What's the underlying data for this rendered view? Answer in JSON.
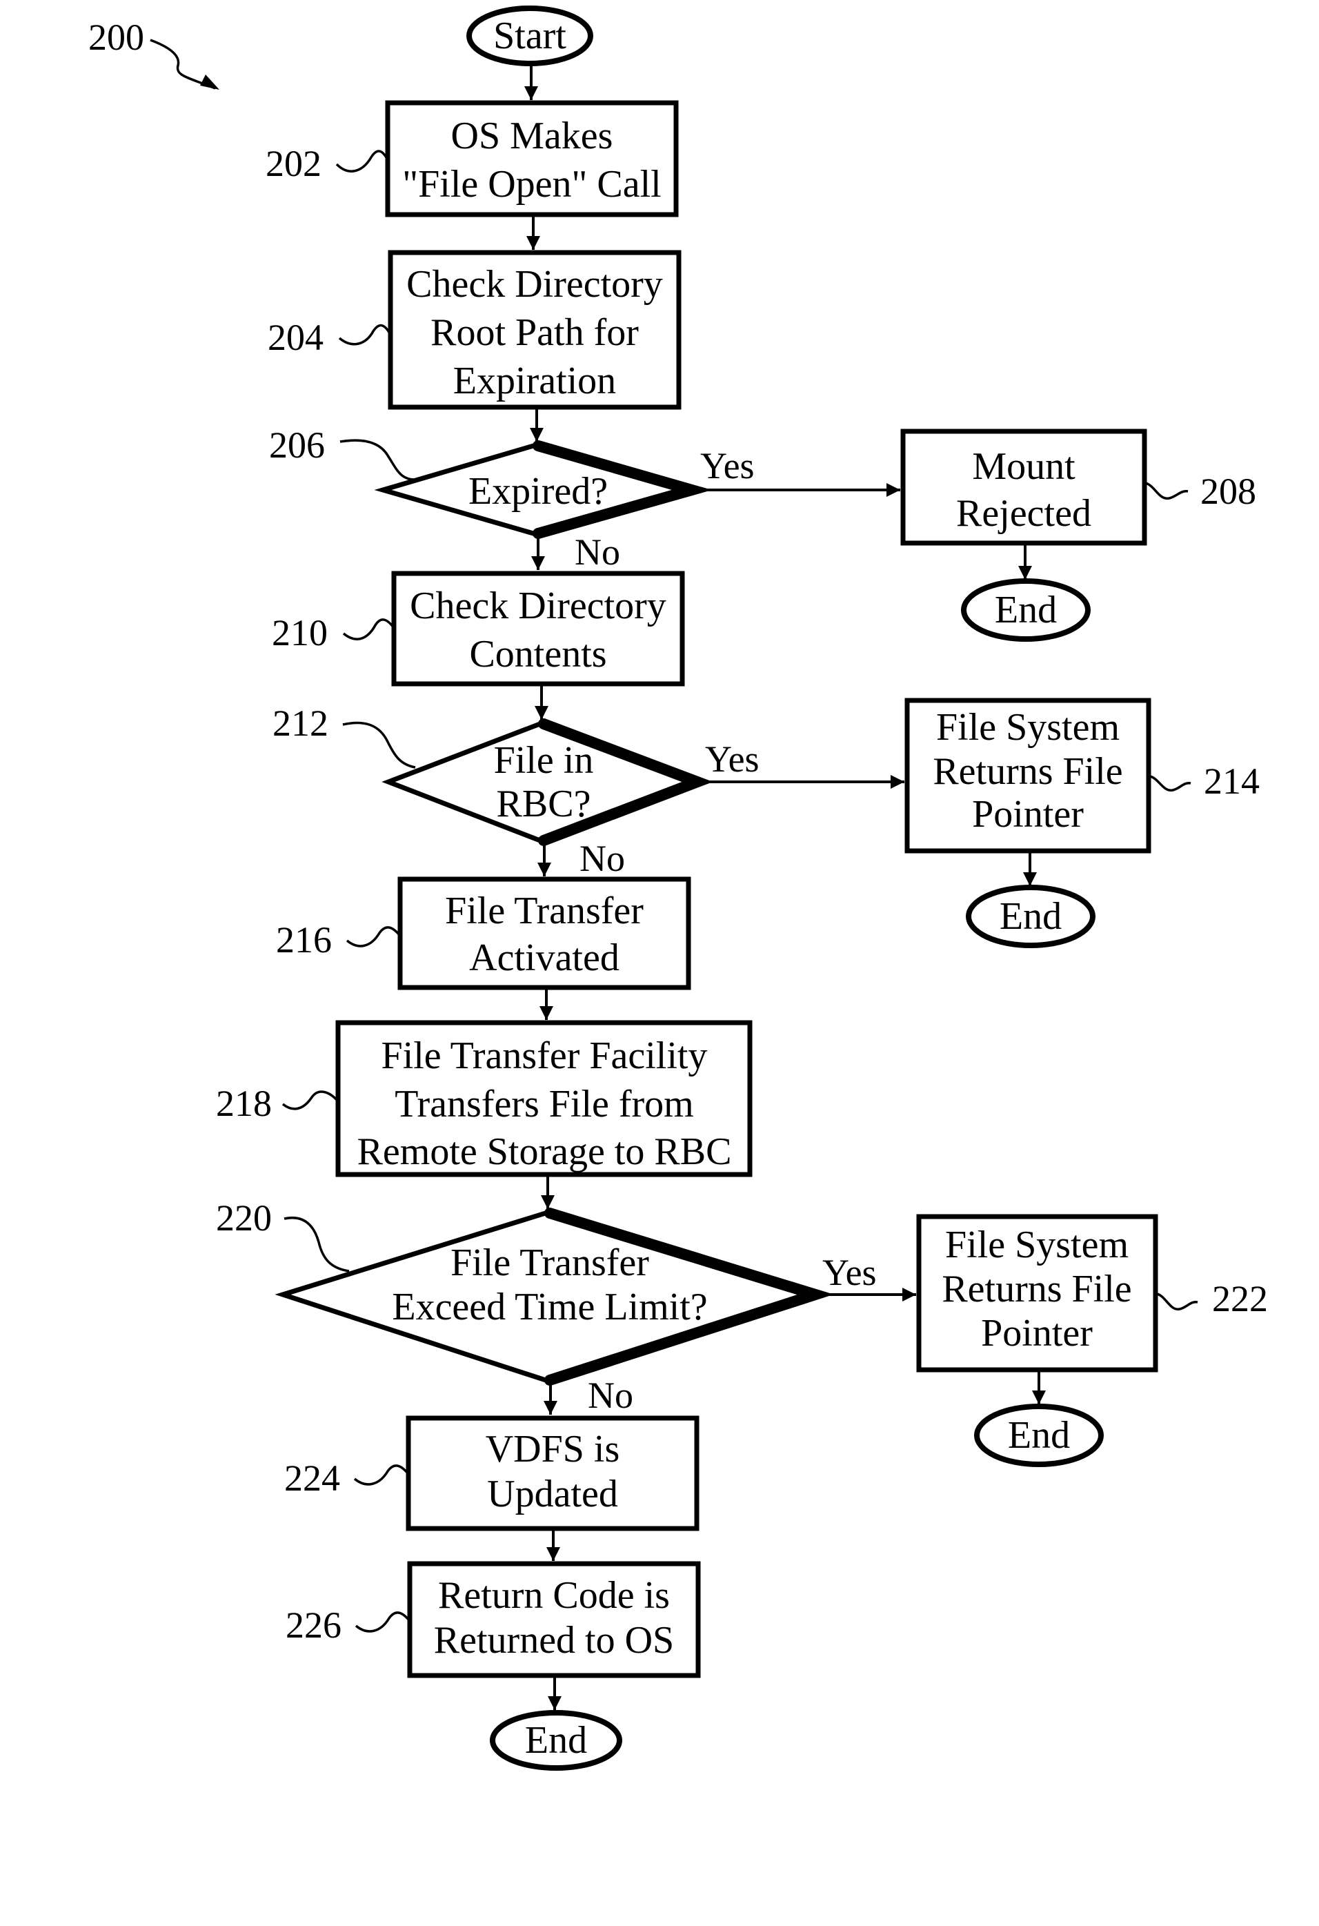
{
  "figure": {
    "reference": "200",
    "start": "Start",
    "end": "End",
    "yes": "Yes",
    "no": "No"
  },
  "steps": {
    "s202": {
      "ref": "202",
      "lines": [
        "OS Makes",
        "\"File Open\" Call"
      ]
    },
    "s204": {
      "ref": "204",
      "lines": [
        "Check Directory",
        "Root Path for",
        "Expiration"
      ]
    },
    "s206": {
      "ref": "206",
      "lines": [
        "Expired?"
      ]
    },
    "s208": {
      "ref": "208",
      "lines": [
        "Mount",
        "Rejected"
      ]
    },
    "s210": {
      "ref": "210",
      "lines": [
        "Check Directory",
        "Contents"
      ]
    },
    "s212": {
      "ref": "212",
      "lines": [
        "File in",
        "RBC?"
      ]
    },
    "s214": {
      "ref": "214",
      "lines": [
        "File System",
        "Returns File",
        "Pointer"
      ]
    },
    "s216": {
      "ref": "216",
      "lines": [
        "File Transfer",
        "Activated"
      ]
    },
    "s218": {
      "ref": "218",
      "lines": [
        "File Transfer Facility",
        "Transfers File from",
        "Remote Storage to RBC"
      ]
    },
    "s220": {
      "ref": "220",
      "lines": [
        "File Transfer",
        "Exceed Time Limit?"
      ]
    },
    "s222": {
      "ref": "222",
      "lines": [
        "File System",
        "Returns File",
        "Pointer"
      ]
    },
    "s224": {
      "ref": "224",
      "lines": [
        "VDFS is",
        "Updated"
      ]
    },
    "s226": {
      "ref": "226",
      "lines": [
        "Return Code is",
        "Returned to OS"
      ]
    }
  }
}
